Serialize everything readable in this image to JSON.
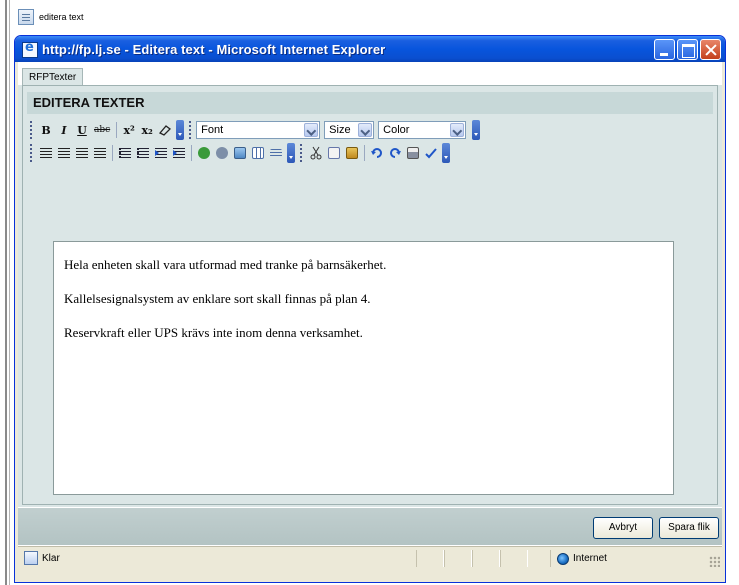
{
  "outer": {
    "tab_label": "editera text"
  },
  "window": {
    "title": "http://fp.lj.se - Editera text - Microsoft Internet Explorer"
  },
  "tabs": [
    {
      "label": "RFPTexter"
    }
  ],
  "panel": {
    "header": "EDITERA TEXTER"
  },
  "toolbar": {
    "row1": {
      "bold": "B",
      "italic": "I",
      "underline": "U",
      "strike": "abc",
      "superscript": "x²",
      "subscript": "x₂",
      "font_select": "Font",
      "size_select": "Size",
      "color_select": "Color"
    }
  },
  "editor": {
    "paragraphs": [
      "Hela enheten skall vara utformad med tranke på barnsäkerhet.",
      "Kallelsesignalsystem av enklare sort skall finnas på plan 4.",
      "Reservkraft eller UPS krävs inte inom denna verksamhet."
    ]
  },
  "buttons": {
    "cancel": "Avbryt",
    "save": "Spara flik"
  },
  "status": {
    "left": "Klar",
    "zone": "Internet"
  },
  "colors": {
    "titlebar": "#0855dd",
    "panel_bg": "#dbe6e6",
    "header_bg": "#c7d8d8"
  }
}
